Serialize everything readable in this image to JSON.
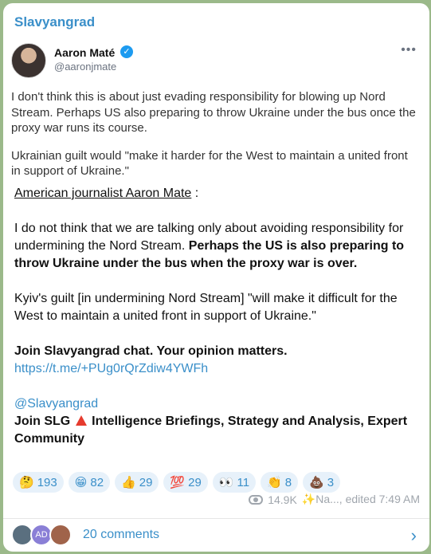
{
  "channel": {
    "name": "Slavyangrad"
  },
  "tweet": {
    "author": "Aaron Maté",
    "handle": "@aaronjmate",
    "paragraphs": [
      "I don't think this is about just evading responsibility for blowing up Nord Stream. Perhaps US also preparing to throw Ukraine under the bus once the proxy war runs its course.",
      "Ukrainian guilt would \"make it harder for the West to maintain a united front in support of Ukraine.\""
    ]
  },
  "post": {
    "intro_underlined": "American journalist Aaron Mate",
    "intro_colon": " :",
    "p1_normal": "I do not think that we are talking only about avoiding responsibility for undermining the Nord Stream. ",
    "p1_bold": "Perhaps the US is also preparing to throw Ukraine under the bus when the proxy war is over.",
    "p2": "Kyiv's guilt [in undermining Nord Stream] \"will make it difficult for the West to maintain a united front in support of Ukraine.\"",
    "join_chat": "Join Slavyangrad chat. Your opinion matters.",
    "chat_link": "https://t.me/+PUg0rQrZdiw4YWFh",
    "mention": "@Slavyangrad",
    "join_slg_a": "Join SLG",
    "join_slg_b": " Intelligence Briefings, Strategy and Analysis, Expert Community"
  },
  "reactions": [
    {
      "emoji": "🤔",
      "count": "193"
    },
    {
      "emoji": "😁",
      "count": "82"
    },
    {
      "emoji": "👍",
      "count": "29"
    },
    {
      "emoji": "💯",
      "count": "29"
    },
    {
      "emoji": "👀",
      "count": "11"
    },
    {
      "emoji": "👏",
      "count": "8"
    },
    {
      "emoji": "💩",
      "count": "3"
    }
  ],
  "meta": {
    "views": "14.9K",
    "signature": "✨Na..., edited 7:49 AM"
  },
  "comments": {
    "label": "20 comments",
    "avatar_initials": "AD"
  }
}
